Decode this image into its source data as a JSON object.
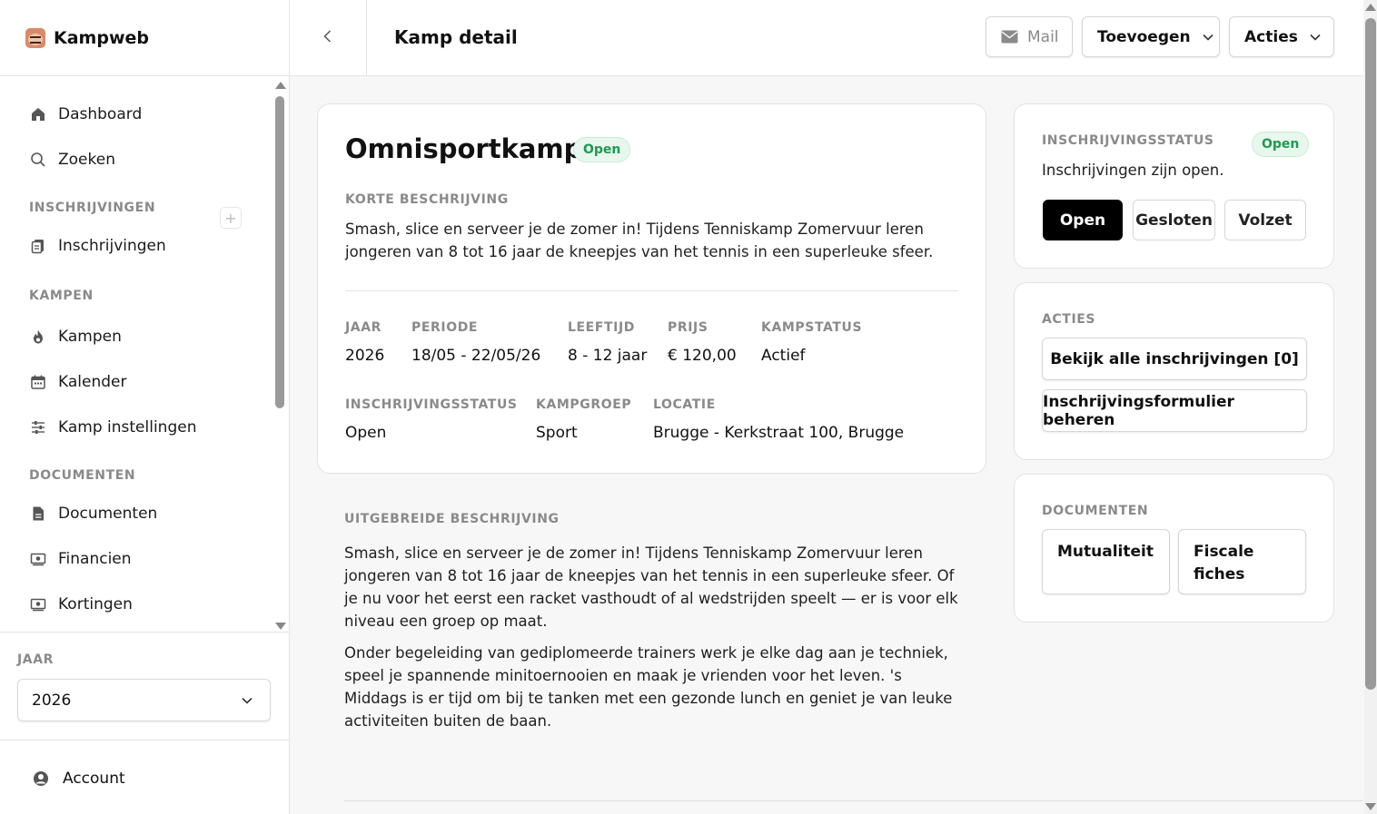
{
  "app": {
    "name": "Kampweb"
  },
  "sidebar": {
    "items": {
      "dashboard": "Dashboard",
      "zoeken": "Zoeken",
      "inschrijvingen": "Inschrijvingen",
      "kampen": "Kampen",
      "kalender": "Kalender",
      "kamp_instellingen": "Kamp instellingen",
      "documenten": "Documenten",
      "financien": "Financien",
      "kortingen": "Kortingen"
    },
    "sections": {
      "inschrijvingen": "INSCHRIJVINGEN",
      "kampen": "KAMPEN",
      "documenten": "DOCUMENTEN"
    },
    "add_symbol": "+",
    "year": {
      "label": "JAAR",
      "value": "2026"
    },
    "account": "Account"
  },
  "header": {
    "title": "Kamp detail",
    "buttons": {
      "mail": "Mail",
      "toevoegen": "Toevoegen",
      "acties": "Acties"
    }
  },
  "camp": {
    "title": "Omnisportkamp",
    "status_badge": "Open",
    "short_desc_label": "KORTE BESCHRIJVING",
    "short_desc": "Smash, slice en serveer je de zomer in! Tijdens Tenniskamp Zomervuur leren jongeren van 8 tot 16 jaar de kneepjes van het tennis in een superleuke sfeer.",
    "fields": {
      "jaar": {
        "label": "JAAR",
        "value": "2026"
      },
      "periode": {
        "label": "PERIODE",
        "value": "18/05 - 22/05/26"
      },
      "leeftijd": {
        "label": "LEEFTIJD",
        "value": "8 - 12 jaar"
      },
      "prijs": {
        "label": "PRIJS",
        "value": "€ 120,00"
      },
      "kampstatus": {
        "label": "KAMPSTATUS",
        "value": "Actief"
      },
      "inschrijvingsstatus": {
        "label": "INSCHRIJVINGSSTATUS",
        "value": "Open"
      },
      "kampgroep": {
        "label": "KAMPGROEP",
        "value": "Sport"
      },
      "locatie": {
        "label": "LOCATIE",
        "value": "Brugge - Kerkstraat 100, Brugge"
      }
    },
    "extended_label": "UITGEBREIDE BESCHRIJVING",
    "extended_p1": "Smash, slice en serveer je de zomer in! Tijdens Tenniskamp Zomervuur leren jongeren van 8 tot 16 jaar de kneepjes van het tennis in een superleuke sfeer. Of je nu voor het eerst een racket vasthoudt of al wedstrijden speelt — er is voor elk niveau een groep op maat.",
    "extended_p2": "Onder begeleiding van gediplomeerde trainers werk je elke dag aan je techniek, speel je spannende minitoernooien en maak je vrienden voor het leven. 's Middags is er tijd om bij te tanken met een gezonde lunch en geniet je van leuke activiteiten buiten de baan."
  },
  "registration": {
    "label": "INSCHRIJVINGSSTATUS",
    "badge": "Open",
    "text": "Inschrijvingen zijn open.",
    "options": [
      "Open",
      "Gesloten",
      "Volzet"
    ],
    "selected": "Open"
  },
  "actions": {
    "label": "ACTIES",
    "view_all": "Bekijk alle inschrijvingen [0]",
    "manage_form": "Inschrijvingsformulier beheren"
  },
  "documents": {
    "label": "DOCUMENTEN",
    "mutualiteit": "Mutualiteit",
    "fiscale": "Fiscale fiches"
  },
  "colors": {
    "badge_bg": "#e8f7ee",
    "badge_text": "#1e9a4f",
    "active_btn": "#000000"
  }
}
